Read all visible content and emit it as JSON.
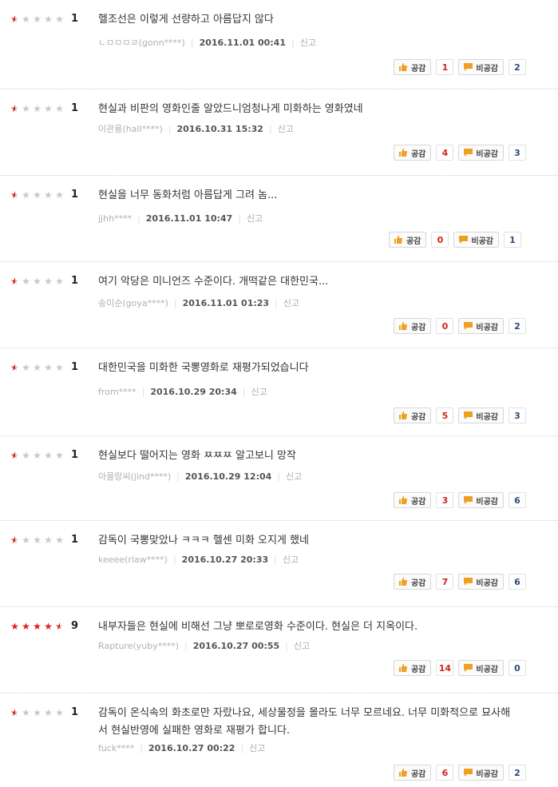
{
  "labels": {
    "like": "공감",
    "dislike": "비공감",
    "report": "신고"
  },
  "colors": {
    "star_on": "#e02020",
    "star_off": "#c8c8c8",
    "like_count": "#d1241f",
    "dislike_count": "#2e4a7f"
  },
  "reviews": [
    {
      "rating_stars": 0.5,
      "score": "1",
      "comment": "헬조선은 이렇게 선량하고 아름답지 않다",
      "user": "ㄴㅁㅁㅁㄹ(gonn****)",
      "date": "2016.11.01 00:41",
      "likes": "1",
      "dislikes": "2"
    },
    {
      "rating_stars": 0.5,
      "score": "1",
      "comment": "현실과 비판의 영화인줄 알았드니엄청나게 미화하는 영화였네",
      "user": "이관용(hall****)",
      "date": "2016.10.31 15:32",
      "likes": "4",
      "dislikes": "3"
    },
    {
      "rating_stars": 0.5,
      "score": "1",
      "comment": "현실을 너무 동화처럼 아름답게 그려 놈...",
      "user": "jjhh****",
      "date": "2016.11.01 10:47",
      "likes": "0",
      "dislikes": "1"
    },
    {
      "rating_stars": 0.5,
      "score": "1",
      "comment": "여기 악당은 미니언즈 수준이다. 개떡같은 대한민국...",
      "user": "송미순(goya****)",
      "date": "2016.11.01 01:23",
      "likes": "0",
      "dislikes": "2"
    },
    {
      "rating_stars": 0.5,
      "score": "1",
      "comment": "대한민국을 미화한 국뽕영화로 재평가되었습니다",
      "user": "from****",
      "date": "2016.10.29 20:34",
      "likes": "5",
      "dislikes": "3"
    },
    {
      "rating_stars": 0.5,
      "score": "1",
      "comment": "현실보다 떨어지는 영화 ㅉㅉㅉ 알고보니 망작",
      "user": "아몰랑씨(jind****)",
      "date": "2016.10.29 12:04",
      "likes": "3",
      "dislikes": "6"
    },
    {
      "rating_stars": 0.5,
      "score": "1",
      "comment": "감독이 국뽕맞았나 ㅋㅋㅋ 헬센 미화 오지게 했네",
      "user": "keeee(rlaw****)",
      "date": "2016.10.27 20:33",
      "likes": "7",
      "dislikes": "6"
    },
    {
      "rating_stars": 4.5,
      "score": "9",
      "comment": "내부자들은 현실에 비해선 그냥 뽀로로영화 수준이다. 현실은 더 지옥이다.",
      "user": "Rapture(yuby****)",
      "date": "2016.10.27 00:55",
      "likes": "14",
      "dislikes": "0"
    },
    {
      "rating_stars": 0.5,
      "score": "1",
      "comment": "감독이 온식속의 화초로만 자랐나요, 세상물정을 몰라도 너무 모르네요. 너무 미화적으로 묘사해서 현실반영에 실패한 영화로 재평가 합니다.",
      "user": "fuck****",
      "date": "2016.10.27 00:22",
      "likes": "6",
      "dislikes": "2"
    }
  ]
}
